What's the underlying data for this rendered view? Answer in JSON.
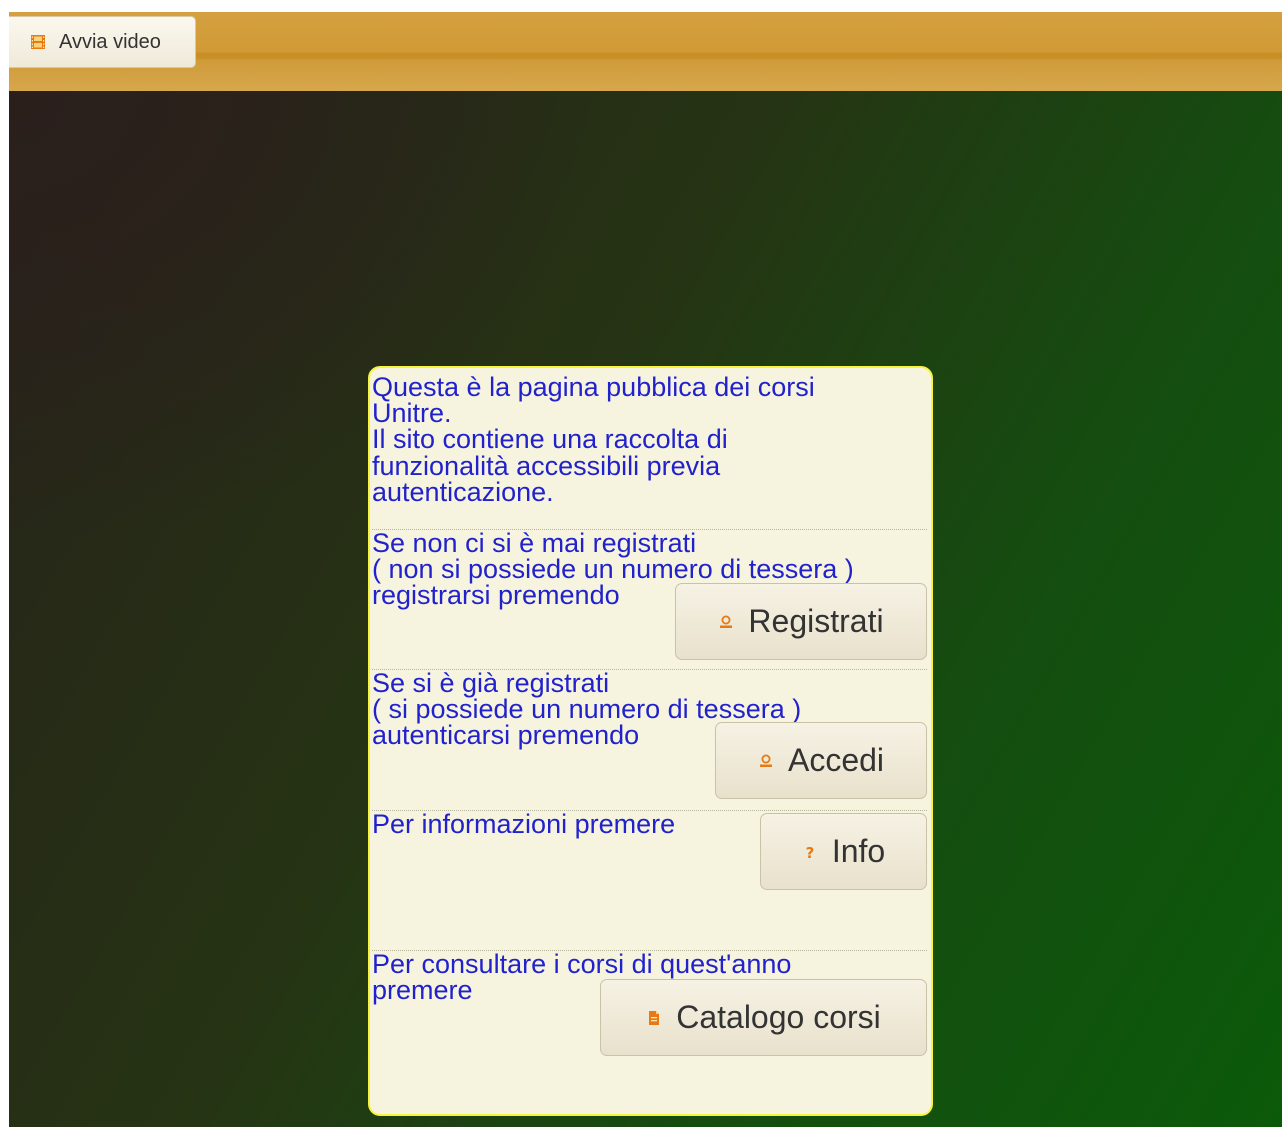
{
  "toolbar": {
    "video_button_label": "Avvia video",
    "video_icon": "film-icon"
  },
  "panel": {
    "intro_lines": [
      "Questa è la pagina pubblica dei corsi",
      "Unitre.",
      "Il sito contiene una raccolta di",
      "funzionalità accessibili previa",
      "autenticazione."
    ],
    "register": {
      "lines": [
        "Se non ci si è mai registrati",
        "( non si possiede un numero di tessera )",
        "registrarsi premendo"
      ],
      "button_label": "Registrati",
      "button_icon": "user-icon"
    },
    "login": {
      "lines": [
        "Se si è già registrati",
        "( si possiede un numero di tessera )",
        "autenticarsi premendo"
      ],
      "button_label": "Accedi",
      "button_icon": "user-icon"
    },
    "info": {
      "lines": [
        "Per informazioni premere"
      ],
      "button_label": "Info",
      "button_icon": "question-icon"
    },
    "catalog": {
      "lines": [
        "Per consultare i corsi di quest'anno",
        "premere"
      ],
      "button_label": "Catalogo corsi",
      "button_icon": "document-icon"
    }
  },
  "colors": {
    "panel_text": "#2222cc",
    "panel_border": "#f7f53a",
    "panel_background": "#f6f4df",
    "topbar": "#d19a36",
    "icon_accent": "#e87a14"
  }
}
